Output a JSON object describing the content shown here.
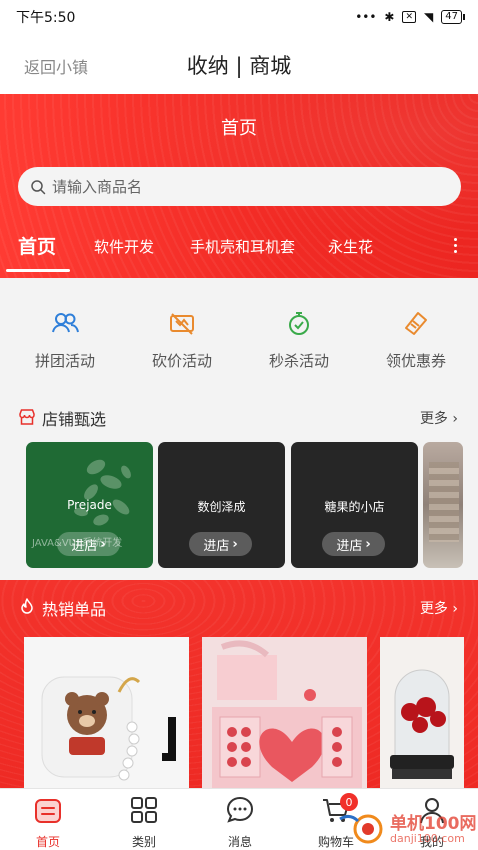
{
  "status_bar": {
    "time": "下午5:50",
    "dots": "•••",
    "bluetooth": "✱",
    "x_icon": "✕",
    "wifi": "◥",
    "battery": "47"
  },
  "title_bar": {
    "back": "返回小镇",
    "title": "收纳 | 商城"
  },
  "header": {
    "title": "首页",
    "search_placeholder": "请输入商品名",
    "tabs": [
      "首页",
      "软件开发",
      "手机壳和耳机套",
      "永生花"
    ]
  },
  "activities": [
    {
      "label": "拼团活动",
      "icon": "group-icon",
      "color": "#2f7fd9"
    },
    {
      "label": "砍价活动",
      "icon": "bargain-icon",
      "color": "#e98a2e"
    },
    {
      "label": "秒杀活动",
      "icon": "stopwatch-icon",
      "color": "#3aaa4a"
    },
    {
      "label": "领优惠券",
      "icon": "coupon-icon",
      "color": "#e98a2e"
    }
  ],
  "stores_section": {
    "title": "店铺甄选",
    "more": "更多"
  },
  "stores": [
    {
      "name": "Prejade",
      "enter": "进店",
      "bg": "#1f6a34",
      "watermark": "JAVA&VUE系统开发"
    },
    {
      "name": "数创泽成",
      "enter": "进店",
      "bg": "#262626"
    },
    {
      "name": "糖果的小店",
      "enter": "进店",
      "bg": "#262626"
    }
  ],
  "hot_section": {
    "title": "热销单品",
    "more": "更多"
  },
  "bottom_nav": [
    {
      "label": "首页",
      "icon": "home-icon",
      "active": true
    },
    {
      "label": "类别",
      "icon": "category-grid-icon"
    },
    {
      "label": "消息",
      "icon": "message-icon"
    },
    {
      "label": "购物车",
      "icon": "cart-icon",
      "badge": "0"
    },
    {
      "label": "我的",
      "icon": "profile-icon"
    }
  ],
  "site_watermark": {
    "cn": "单机100网",
    "en": "danji100.com"
  },
  "colors": {
    "brand_red": "#f12a24",
    "active_nav": "#e8302a"
  }
}
